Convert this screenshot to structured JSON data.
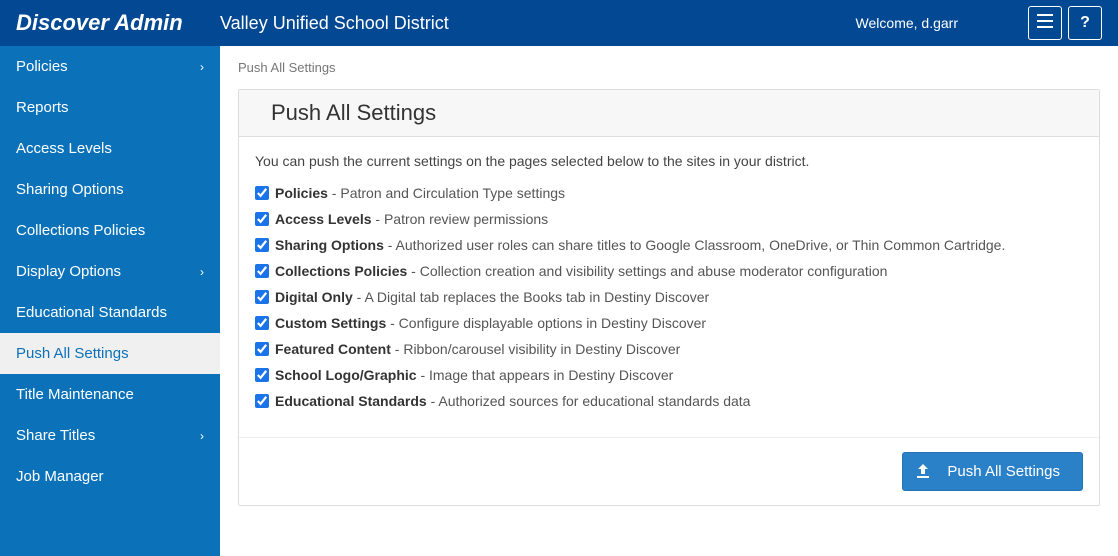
{
  "header": {
    "app_title": "Discover Admin",
    "district": "Valley Unified School District",
    "welcome": "Welcome, d.garr"
  },
  "sidebar": {
    "items": [
      {
        "label": "Policies",
        "expandable": true
      },
      {
        "label": "Reports",
        "expandable": false
      },
      {
        "label": "Access Levels",
        "expandable": false
      },
      {
        "label": "Sharing Options",
        "expandable": false
      },
      {
        "label": "Collections Policies",
        "expandable": false
      },
      {
        "label": "Display Options",
        "expandable": true
      },
      {
        "label": "Educational Standards",
        "expandable": false
      },
      {
        "label": "Push All Settings",
        "expandable": false,
        "active": true
      },
      {
        "label": "Title Maintenance",
        "expandable": false
      },
      {
        "label": "Share Titles",
        "expandable": true
      },
      {
        "label": "Job Manager",
        "expandable": false
      }
    ]
  },
  "breadcrumb": "Push All Settings",
  "panel": {
    "title": "Push All Settings",
    "intro": "You can push the current settings on the pages selected below to the sites in your district.",
    "settings": [
      {
        "label": "Policies",
        "desc": " - Patron and Circulation Type settings",
        "checked": true
      },
      {
        "label": "Access Levels",
        "desc": " - Patron review permissions",
        "checked": true
      },
      {
        "label": "Sharing Options",
        "desc": " - Authorized user roles can share titles to Google Classroom, OneDrive, or Thin Common Cartridge.",
        "checked": true
      },
      {
        "label": "Collections Policies",
        "desc": " - Collection creation and visibility settings and abuse moderator configuration",
        "checked": true
      },
      {
        "label": "Digital Only",
        "desc": " - A Digital tab replaces the Books tab in Destiny Discover",
        "checked": true
      },
      {
        "label": "Custom Settings",
        "desc": " - Configure displayable options in Destiny Discover",
        "checked": true
      },
      {
        "label": "Featured Content",
        "desc": " - Ribbon/carousel visibility in Destiny Discover",
        "checked": true
      },
      {
        "label": "School Logo/Graphic",
        "desc": " - Image that appears in Destiny Discover",
        "checked": true
      },
      {
        "label": "Educational Standards",
        "desc": " - Authorized sources for educational standards data",
        "checked": true
      }
    ],
    "push_button": "Push All Settings"
  }
}
